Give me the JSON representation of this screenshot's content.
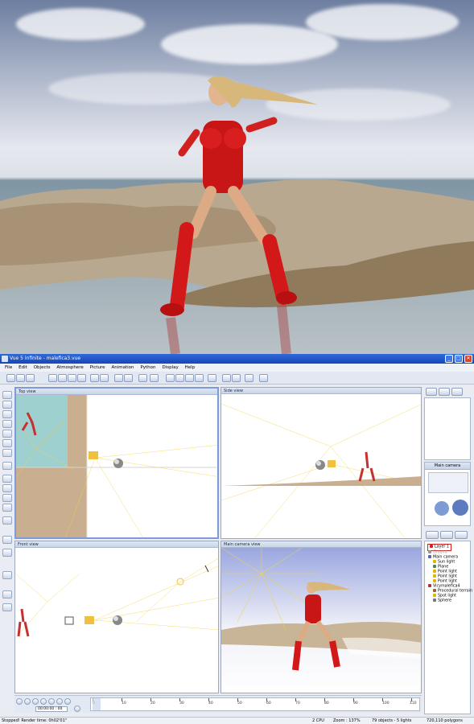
{
  "window": {
    "title": "Vue 5 Infinite - malefica3.vue",
    "controls": [
      "_",
      "□",
      "✕"
    ]
  },
  "menu": [
    "File",
    "Edit",
    "Objects",
    "Atmosphere",
    "Picture",
    "Animation",
    "Python",
    "Display",
    "Help"
  ],
  "viewports": {
    "top": "Top view",
    "side": "Side view",
    "front": "Front view",
    "camera": "Main camera view"
  },
  "camera_panel": {
    "title": "Main camera"
  },
  "world_browser": {
    "items": [
      {
        "label": "Layer 1",
        "color": "#cc2222"
      },
      {
        "label": "Ground",
        "color": "#999999"
      },
      {
        "label": "Main camera",
        "color": "#5566aa"
      },
      {
        "label": "Sun light",
        "color": "#e8b400"
      },
      {
        "label": "Plane",
        "color": "#4a8a4a"
      },
      {
        "label": "Point light",
        "color": "#e8b400"
      },
      {
        "label": "Point light",
        "color": "#e8b400"
      },
      {
        "label": "Point light",
        "color": "#e8b400"
      },
      {
        "label": "Vicymalefica4",
        "color": "#aa3333"
      },
      {
        "label": "Procedural terrain",
        "color": "#8a6a3a"
      },
      {
        "label": "Spot light",
        "color": "#e8b400"
      },
      {
        "label": "Sphere",
        "color": "#777777"
      }
    ]
  },
  "timeline": {
    "time": "00:00:00 : 00",
    "ticks": [
      "0",
      "10",
      "20",
      "30",
      "40",
      "50",
      "60",
      "70",
      "80",
      "90",
      "100",
      "110"
    ]
  },
  "status": {
    "message": "Stopped! Render time: 0h02'01\"",
    "cpu": "2 CPU",
    "zoom": "Zoom : 137%",
    "objects": "79 objects - 5 lights",
    "polygons": "720,110 polygons"
  }
}
